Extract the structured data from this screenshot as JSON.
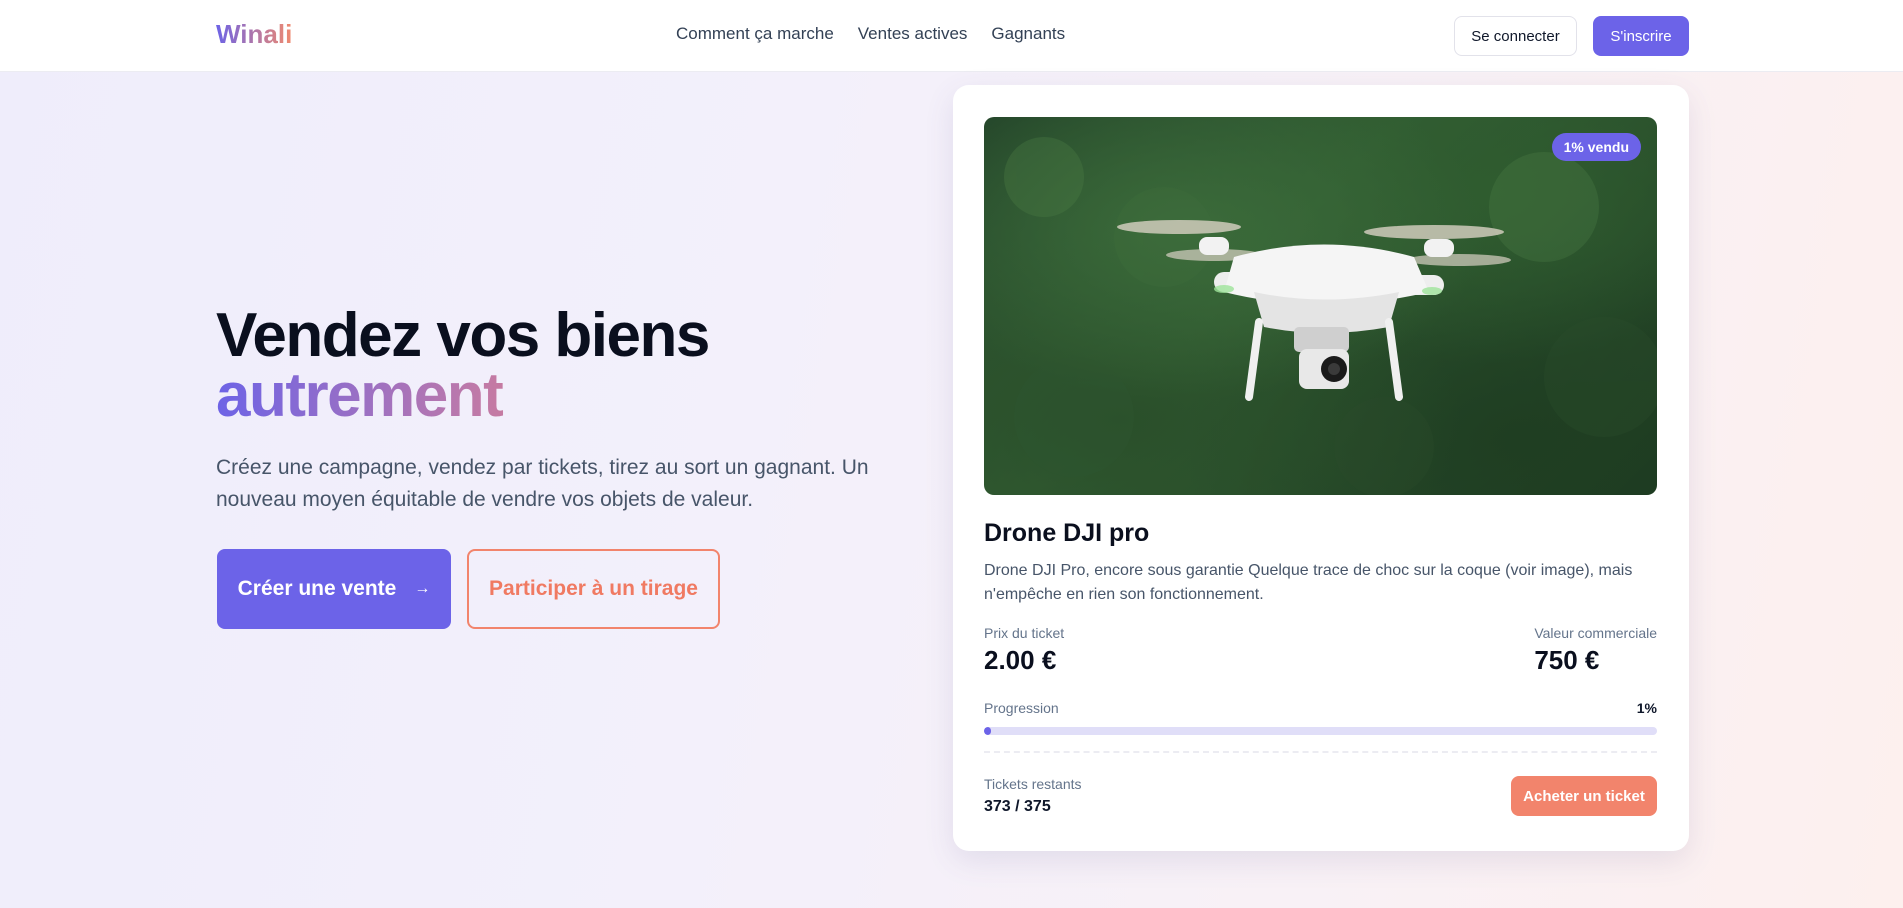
{
  "header": {
    "logo": "Winali",
    "nav": [
      "Comment ça marche",
      "Ventes actives",
      "Gagnants"
    ],
    "login_label": "Se connecter",
    "signup_label": "S'inscrire"
  },
  "hero": {
    "title_line1": "Vendez vos biens",
    "title_line2": "autrement",
    "subtitle": "Créez une campagne, vendez par tickets, tirez au sort un gagnant. Un nouveau moyen équitable de vendre vos objets de valeur.",
    "create_label": "Créer une vente",
    "create_arrow": "→",
    "participate_label": "Participer à un tirage"
  },
  "card": {
    "image_icon": "drone-photo",
    "badge": "1% vendu",
    "title": "Drone DJI pro",
    "description": "Drone DJI Pro, encore sous garantie Quelque trace de choc sur la coque (voir image), mais n'empêche en rien son fonctionnement.",
    "ticket_price_label": "Prix du ticket",
    "ticket_price": "2.00 €",
    "commercial_value_label": "Valeur commerciale",
    "commercial_value": "750 €",
    "progress_label": "Progression",
    "progress_pct": "1%",
    "progress_fraction": 0.01,
    "tickets_label": "Tickets restants",
    "tickets_value": "373 / 375",
    "buy_label": "Acheter un ticket"
  },
  "colors": {
    "primary": "#6c63e8",
    "accent": "#f2846c"
  }
}
